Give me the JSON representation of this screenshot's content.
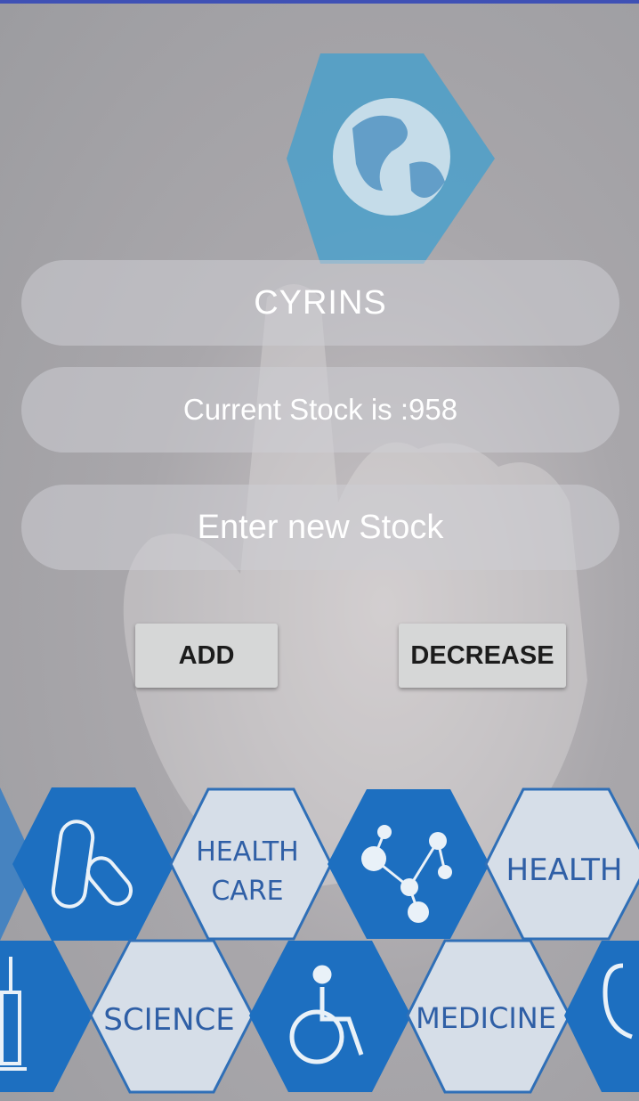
{
  "product": {
    "name": "CYRINS"
  },
  "stock": {
    "current_text": "Current Stock is :958",
    "current_value": 958
  },
  "new_stock_input": {
    "placeholder": "Enter new Stock",
    "value": ""
  },
  "buttons": {
    "add_label": "ADD",
    "decrease_label": "DECREASE"
  },
  "background": {
    "hex_labels": {
      "health_care_line1": "HEALTH",
      "health_care_line2": "CARE",
      "health": "HEALTH",
      "science": "SCIENCE",
      "medicine": "MEDICINE"
    },
    "icons": [
      "globe-icon",
      "pill-capsule-icon",
      "molecule-icon",
      "syringe-icon",
      "wheelchair-icon",
      "stethoscope-icon"
    ]
  },
  "colors": {
    "status_bar": "#3f51b5",
    "hex_blue": "#1d6fc0",
    "button_bg": "#d6d7d7"
  }
}
